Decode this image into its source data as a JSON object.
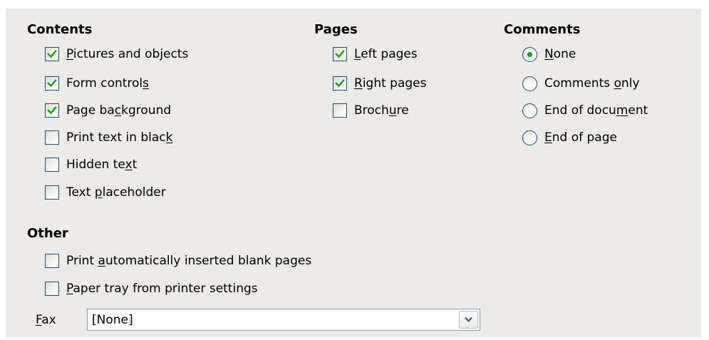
{
  "colors": {
    "panel_background": "#ecebe8",
    "control_border": "#1c5180",
    "checkmark": "#21a121",
    "radio_dot": "#21a121",
    "select_border": "#7f9db9"
  },
  "contents": {
    "heading": "Contents",
    "items": [
      {
        "pre": "",
        "u": "P",
        "post": "ictures and objects",
        "checked": true
      },
      {
        "pre": "Form control",
        "u": "s",
        "post": "",
        "checked": true
      },
      {
        "pre": "Page ba",
        "u": "c",
        "post": "kground",
        "checked": true
      },
      {
        "pre": "Print text in blac",
        "u": "k",
        "post": "",
        "checked": false
      },
      {
        "pre": "Hidden te",
        "u": "x",
        "post": "t",
        "checked": false
      },
      {
        "pre": "Text ",
        "u": "p",
        "post": "laceholder",
        "checked": false
      }
    ]
  },
  "pages": {
    "heading": "Pages",
    "items": [
      {
        "pre": "",
        "u": "L",
        "post": "eft pages",
        "checked": true
      },
      {
        "pre": "",
        "u": "R",
        "post": "ight pages",
        "checked": true
      },
      {
        "pre": "Broch",
        "u": "u",
        "post": "re",
        "checked": false
      }
    ]
  },
  "comments": {
    "heading": "Comments",
    "items": [
      {
        "pre": "",
        "u": "N",
        "post": "one",
        "selected": true
      },
      {
        "pre": "Comments ",
        "u": "o",
        "post": "nly",
        "selected": false
      },
      {
        "pre": "End of docu",
        "u": "m",
        "post": "ent",
        "selected": false
      },
      {
        "pre": "",
        "u": "E",
        "post": "nd of page",
        "selected": false
      }
    ]
  },
  "other": {
    "heading": "Other",
    "items": [
      {
        "pre": "Print ",
        "u": "a",
        "post": "utomatically inserted blank pages",
        "checked": false
      },
      {
        "pre": "",
        "u": "P",
        "post": "aper tray from printer settings",
        "checked": false
      }
    ],
    "fax": {
      "label_u": "F",
      "label_post": "ax",
      "value": "[None]",
      "arrow_icon": "chevron-down-icon"
    }
  }
}
